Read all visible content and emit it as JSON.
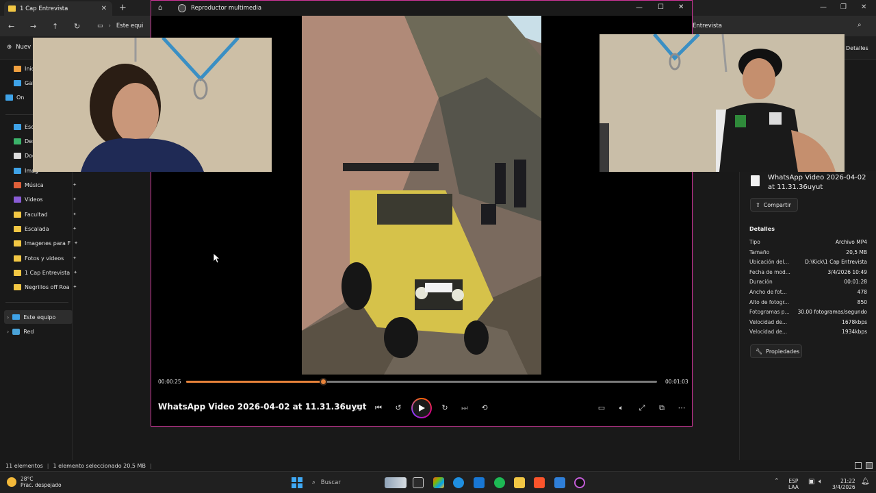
{
  "explorer": {
    "tab_title": "1 Cap Entrevista",
    "address_left": "Este equi",
    "address_right": "Entrevista",
    "new_label": "Nuev",
    "details_label": "Detalles",
    "sidebar": [
      {
        "label": "Inic",
        "type": "home"
      },
      {
        "label": "Gal",
        "type": "gallery"
      },
      {
        "label": "On",
        "type": "cloud"
      },
      {
        "label": "Esc",
        "type": "desktop"
      },
      {
        "label": "Des",
        "type": "download"
      },
      {
        "label": "Doc",
        "type": "docs"
      },
      {
        "label": "Imag",
        "type": "images"
      },
      {
        "label": "Música",
        "type": "music"
      },
      {
        "label": "Videos",
        "type": "video"
      },
      {
        "label": "Facultad",
        "type": "folder"
      },
      {
        "label": "Escalada",
        "type": "folder"
      },
      {
        "label": "Imagenes para F",
        "type": "folder"
      },
      {
        "label": "Fotos y videos",
        "type": "folder"
      },
      {
        "label": "1 Cap Entrevista",
        "type": "folder"
      },
      {
        "label": "Negrillos off Roa",
        "type": "folder"
      }
    ],
    "sidebar_bottom": [
      "Este equipo",
      "Red"
    ],
    "status": {
      "items": "11 elementos",
      "selected": "1 elemento seleccionado  20,5 MB"
    }
  },
  "details_pane": {
    "file_name": "WhatsApp Video 2026-04-02 at 11.31.36uyut",
    "share_label": "Compartir",
    "section_title": "Detalles",
    "rows": [
      {
        "k": "Tipo",
        "v": "Archivo MP4"
      },
      {
        "k": "Tamaño",
        "v": "20,5 MB"
      },
      {
        "k": "Ubicación del...",
        "v": "D:\\Kick\\1 Cap Entrevista"
      },
      {
        "k": "Fecha de mod...",
        "v": "3/4/2026 10:49"
      },
      {
        "k": "Duración",
        "v": "00:01:28"
      },
      {
        "k": "Ancho de fot...",
        "v": "478"
      },
      {
        "k": "Alto de fotogr...",
        "v": "850"
      },
      {
        "k": "Fotogramas p...",
        "v": "30.00 fotogramas/segundo"
      },
      {
        "k": "Velocidad de...",
        "v": "1678kbps"
      },
      {
        "k": "Velocidad de...",
        "v": "1934kbps"
      }
    ],
    "properties_label": "Propiedades"
  },
  "player": {
    "app_title": "Reproductor multimedia",
    "video_title": "WhatsApp Video 2026-04-02 at 11.31.36uyut",
    "current_time": "00:00:25",
    "total_time": "00:01:03",
    "progress": 0.29,
    "plate": "ACP 581"
  },
  "taskbar": {
    "temp": "28°C",
    "weather": "Prac. despejado",
    "search_placeholder": "Buscar",
    "lang1": "ESP",
    "lang2": "LAA",
    "time": "21:22",
    "date": "3/4/2026"
  },
  "colors": {
    "accent": "#e8833a",
    "player_border": "#d0359a",
    "folder": "#f2c744"
  }
}
